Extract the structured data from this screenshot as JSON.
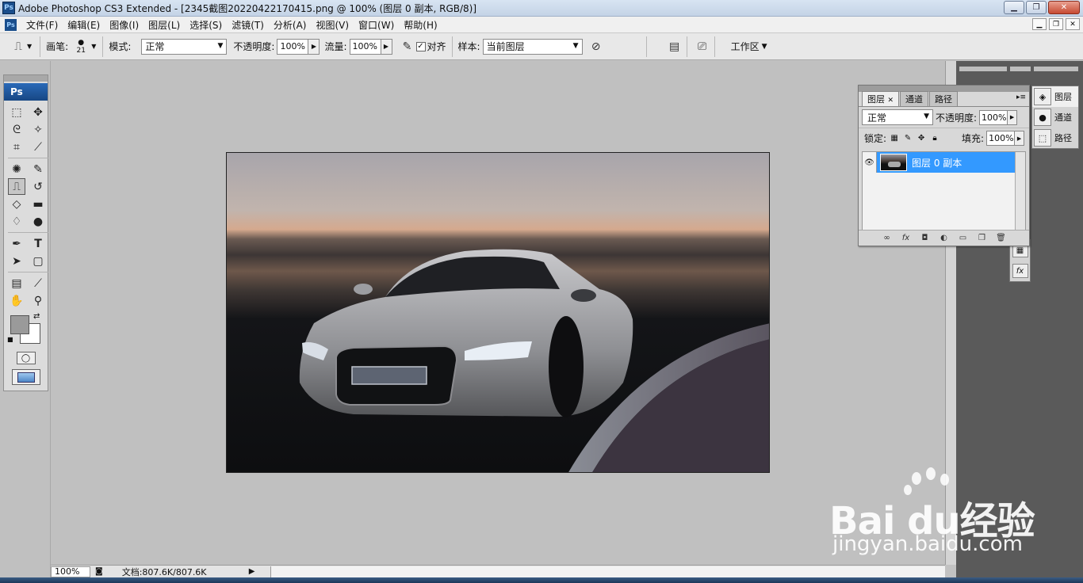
{
  "window": {
    "title": "Adobe Photoshop CS3 Extended - [2345截图20220422170415.png @ 100% (图层 0 副本, RGB/8)]",
    "app_badge": "Ps"
  },
  "menubar": {
    "items": [
      "文件(F)",
      "编辑(E)",
      "图像(I)",
      "图层(L)",
      "选择(S)",
      "滤镜(T)",
      "分析(A)",
      "视图(V)",
      "窗口(W)",
      "帮助(H)"
    ]
  },
  "options_bar": {
    "brush_label": "画笔:",
    "brush_size": "21",
    "mode_label": "模式:",
    "mode_value": "正常",
    "opacity_label": "不透明度:",
    "opacity_value": "100%",
    "flow_label": "流量:",
    "flow_value": "100%",
    "aligned_label": "对齐",
    "aligned_checked": "✓",
    "sample_label": "样本:",
    "sample_value": "当前图层",
    "workspace_label": "工作区"
  },
  "toolbox": {
    "badge": "Ps"
  },
  "status_bar": {
    "zoom": "100%",
    "doc_info": "文档:807.6K/807.6K"
  },
  "layers_panel": {
    "tabs": [
      "图层",
      "通道",
      "路径"
    ],
    "blend_mode": "正常",
    "opacity_label": "不透明度:",
    "opacity_value": "100%",
    "lock_label": "锁定:",
    "fill_label": "填充:",
    "fill_value": "100%",
    "layers": [
      {
        "name": "图层 0 副本",
        "selected": true
      }
    ]
  },
  "dock": {
    "items": [
      "图层",
      "通道",
      "路径"
    ]
  },
  "watermark": {
    "brand": "Bai du经验",
    "domain": "jingyan.baidu.com"
  },
  "colors": {
    "selection": "#3399ff",
    "foreground_swatch": "#9a9a9a",
    "background_swatch": "#ffffff"
  }
}
